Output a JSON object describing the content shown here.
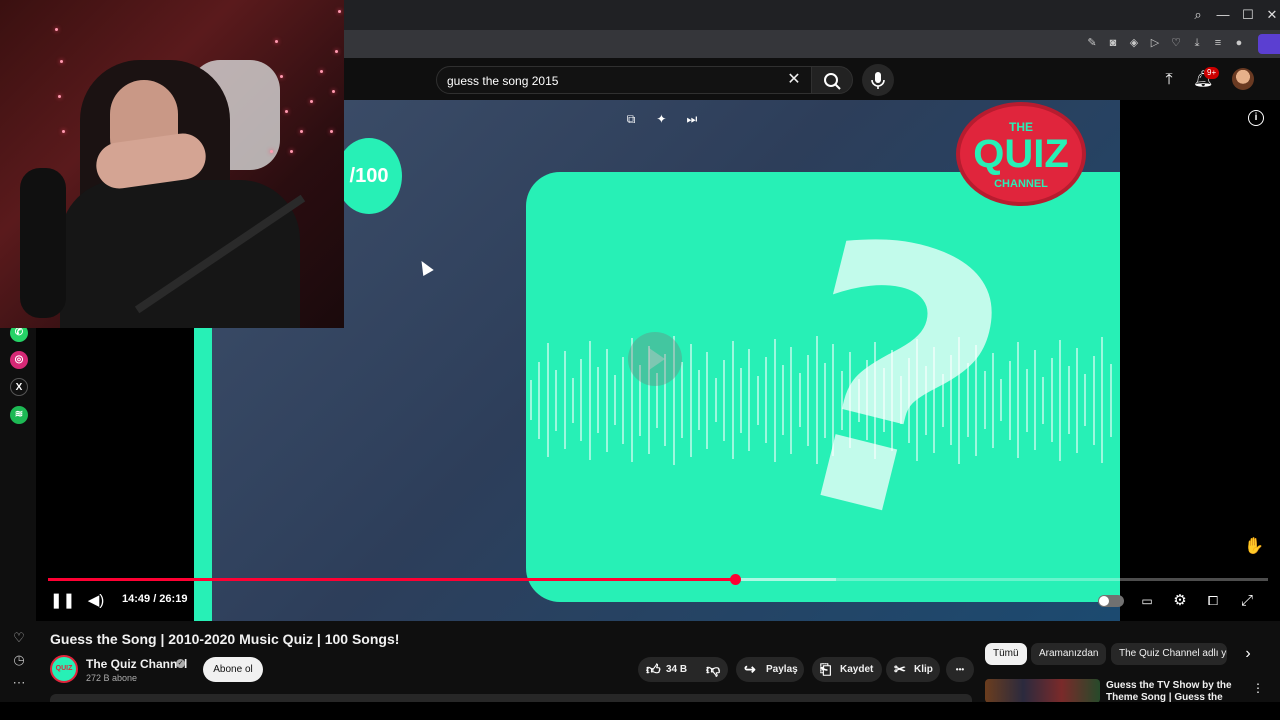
{
  "search": {
    "value": "guess the song 2015",
    "placeholder": ""
  },
  "header": {
    "notification_badge": "9+"
  },
  "video_overlay": {
    "score_badge": "/100",
    "logo_lines": [
      "THE",
      "QUIZ",
      "CHANNEL"
    ],
    "question_mark": "?"
  },
  "player": {
    "time_display": "14:49 / 26:19",
    "progress_fraction": 0.5629,
    "buffer_fraction": 0.6463
  },
  "video": {
    "title": "Guess the Song | 2010-2020 Music Quiz | 100 Songs!",
    "channel_name": "The Quiz Channel",
    "channel_avatar_text": "QUIZ",
    "subscribers": "272 B abone",
    "subscribe_label": "Abone ol"
  },
  "actions": {
    "like_count": "34 B",
    "share_label": "Paylaş",
    "save_label": "Kaydet",
    "clip_label": "Klip",
    "more_label": "•••"
  },
  "chips": [
    "Tümü",
    "Aramanızdan",
    "The Quiz Channel adlı yü"
  ],
  "recommendation": {
    "title": "Guess the TV Show by the Theme Song | Guess the Them"
  },
  "colors": {
    "accent_red": "#ff0033",
    "teal": "#27f0b6",
    "logo_red": "#e0253c"
  },
  "icons": [
    "search-icon",
    "minimize-icon",
    "maximize-icon",
    "close-icon",
    "mic-icon",
    "upload-icon",
    "bell-icon",
    "whatsapp-icon",
    "instagram-icon",
    "x-icon",
    "spotify-icon",
    "heart-icon",
    "clock-icon",
    "pause-icon",
    "volume-icon",
    "subtitles-icon",
    "settings-icon",
    "theater-icon",
    "fullscreen-icon",
    "info-icon",
    "like-icon",
    "dislike-icon",
    "share-icon",
    "save-icon",
    "clip-icon"
  ]
}
